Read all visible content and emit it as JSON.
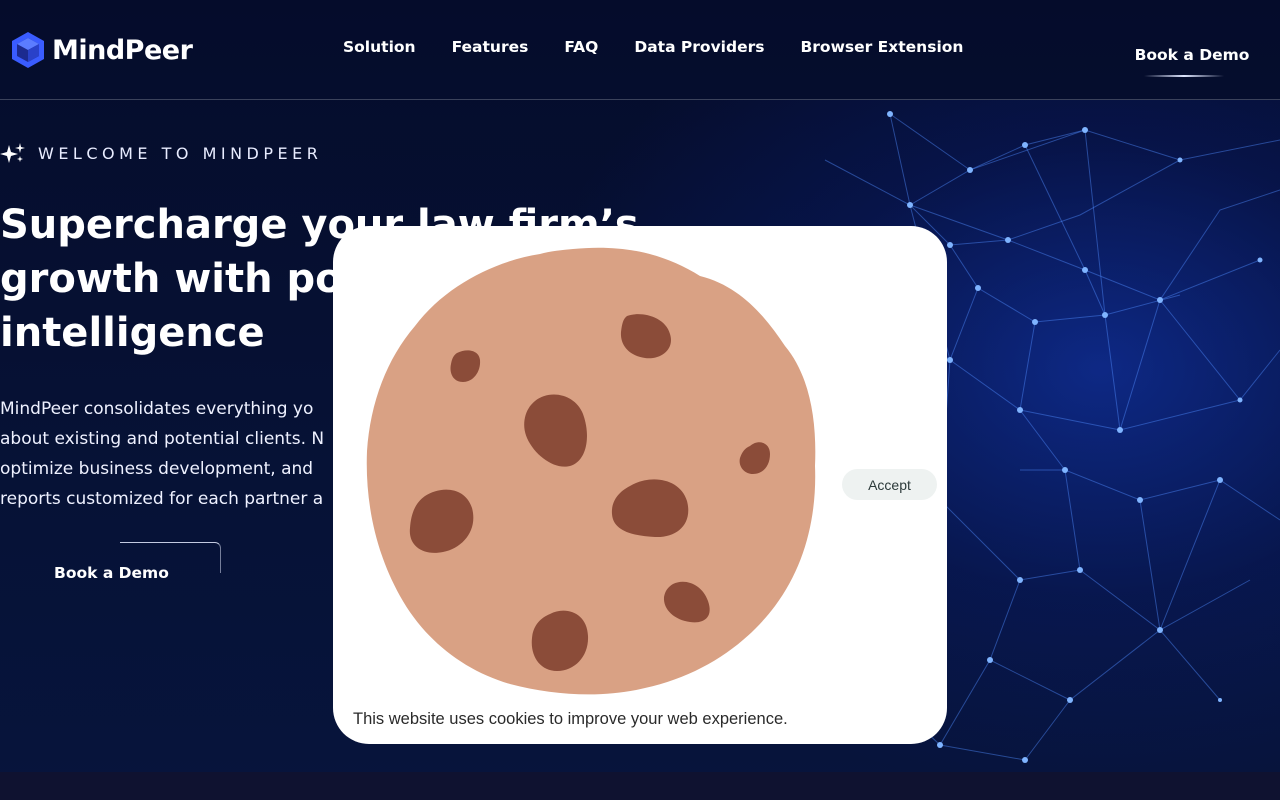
{
  "brand": {
    "name": "MindPeer",
    "logo_icon": "hexagon-cube-logo-icon",
    "accent_color": "#3a5cff"
  },
  "nav": {
    "items": [
      {
        "label": "Solution"
      },
      {
        "label": "Features"
      },
      {
        "label": "FAQ"
      },
      {
        "label": "Data Providers"
      },
      {
        "label": "Browser Extension"
      }
    ],
    "cta_label": "Book a Demo"
  },
  "hero": {
    "eyebrow_icon": "sparkle-icon",
    "eyebrow": "WELCOME TO MINDPEER",
    "headline_lines": [
      "Supercharge your law firm’s",
      "growth with po",
      "intelligence"
    ],
    "description_lines": [
      "MindPeer consolidates everything yo",
      "about existing and potential clients. N",
      "optimize business development, and",
      "reports customized for each partner a"
    ],
    "cta_label": "Book a Demo"
  },
  "cookie_banner": {
    "illustration": "chocolate-chip-cookie-icon",
    "cookie_color": "#d9a184",
    "chip_color": "#8b4c39",
    "accept_label": "Accept",
    "message": "This website uses cookies to improve your web experience."
  },
  "colors": {
    "background": "#06102e",
    "network_glow": "#1f4dff",
    "bottom_strip": "#0f1230"
  }
}
